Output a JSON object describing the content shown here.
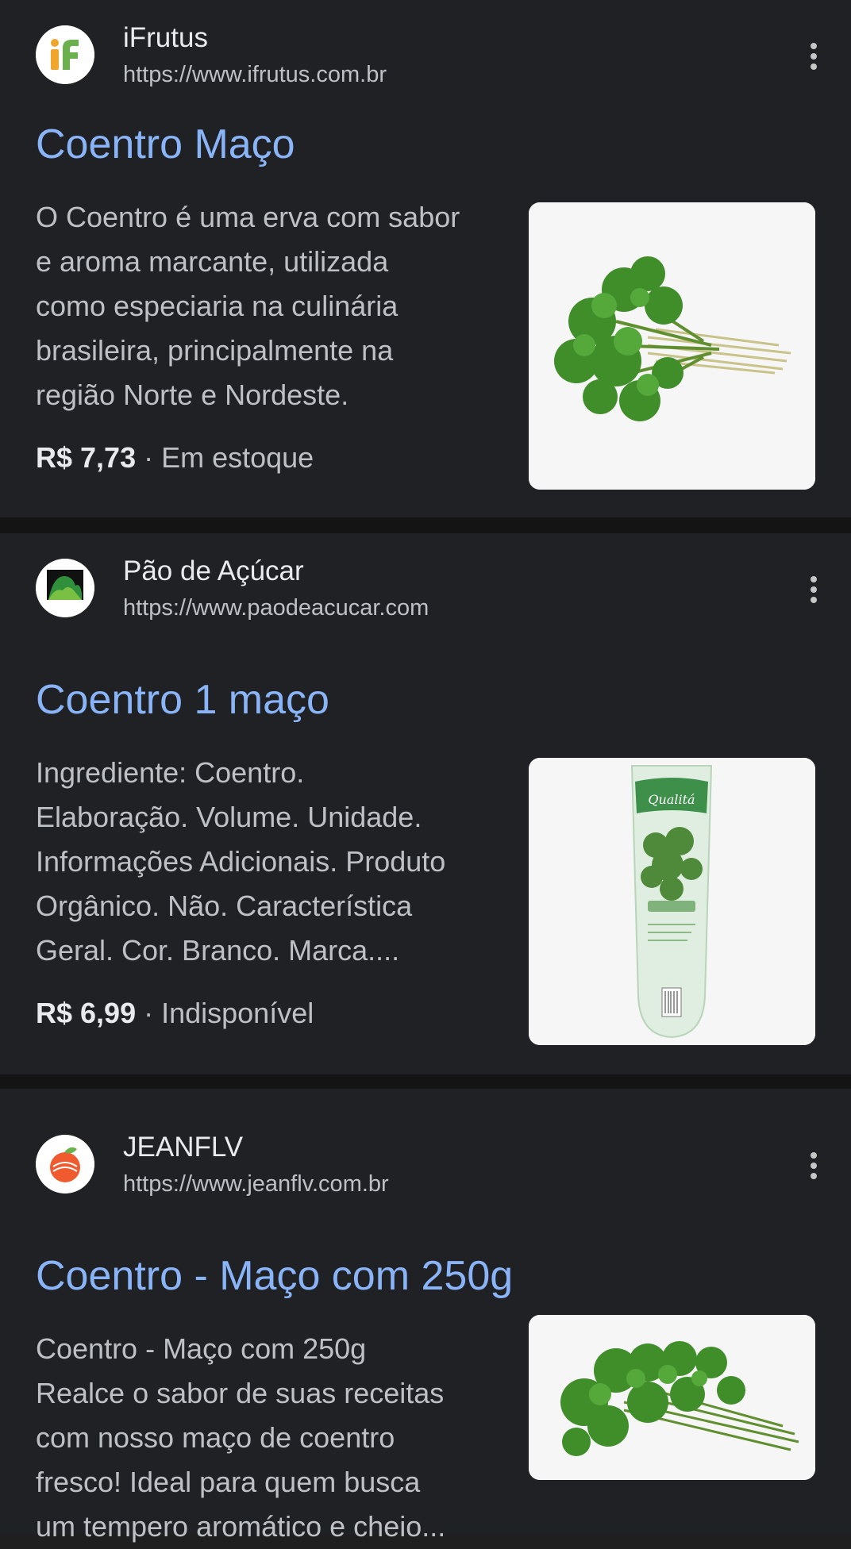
{
  "results": [
    {
      "site_name": "iFrutus",
      "url": "https://www.ifrutus.com.br",
      "favicon_icon": "ifrutus-logo-icon",
      "title": "Coentro Maço",
      "snippet_lines": [
        "O Coentro é uma erva com sabor",
        "e aroma marcante, utilizada",
        "como especiaria na culinária",
        "brasileira, principalmente na",
        "região Norte e Nordeste."
      ],
      "price": "R$ 7,73",
      "separator": " · ",
      "availability": "Em estoque",
      "image": "coriander-bunch-image"
    },
    {
      "site_name": "Pão de Açúcar",
      "url": "https://www.paodeacucar.com",
      "favicon_icon": "pao-de-acucar-logo-icon",
      "title": "Coentro 1 maço",
      "snippet_lines": [
        "Ingrediente: Coentro.",
        "Elaboração. Volume. Unidade.",
        "Informações Adicionais. Produto",
        "Orgânico. Não. Característica",
        "Geral. Cor. Branco. Marca...."
      ],
      "price": "R$ 6,99",
      "separator": " · ",
      "availability": "Indisponível",
      "image": "packaged-coriander-image"
    },
    {
      "site_name": "JEANFLV",
      "url": "https://www.jeanflv.com.br",
      "favicon_icon": "jeanflv-logo-icon",
      "title": "Coentro - Maço com 250g",
      "snippet_lines": [
        "Coentro - Maço com 250g",
        "Realce o sabor de suas receitas",
        "com nosso maço de coentro",
        "fresco! Ideal para quem busca",
        "um tempero aromático e cheio..."
      ],
      "image": "coriander-bunch-image"
    }
  ],
  "colors": {
    "background": "#202124",
    "title_link": "#8ab4f8",
    "snippet_text": "#bdc1c6",
    "separator_band": "#141414"
  }
}
